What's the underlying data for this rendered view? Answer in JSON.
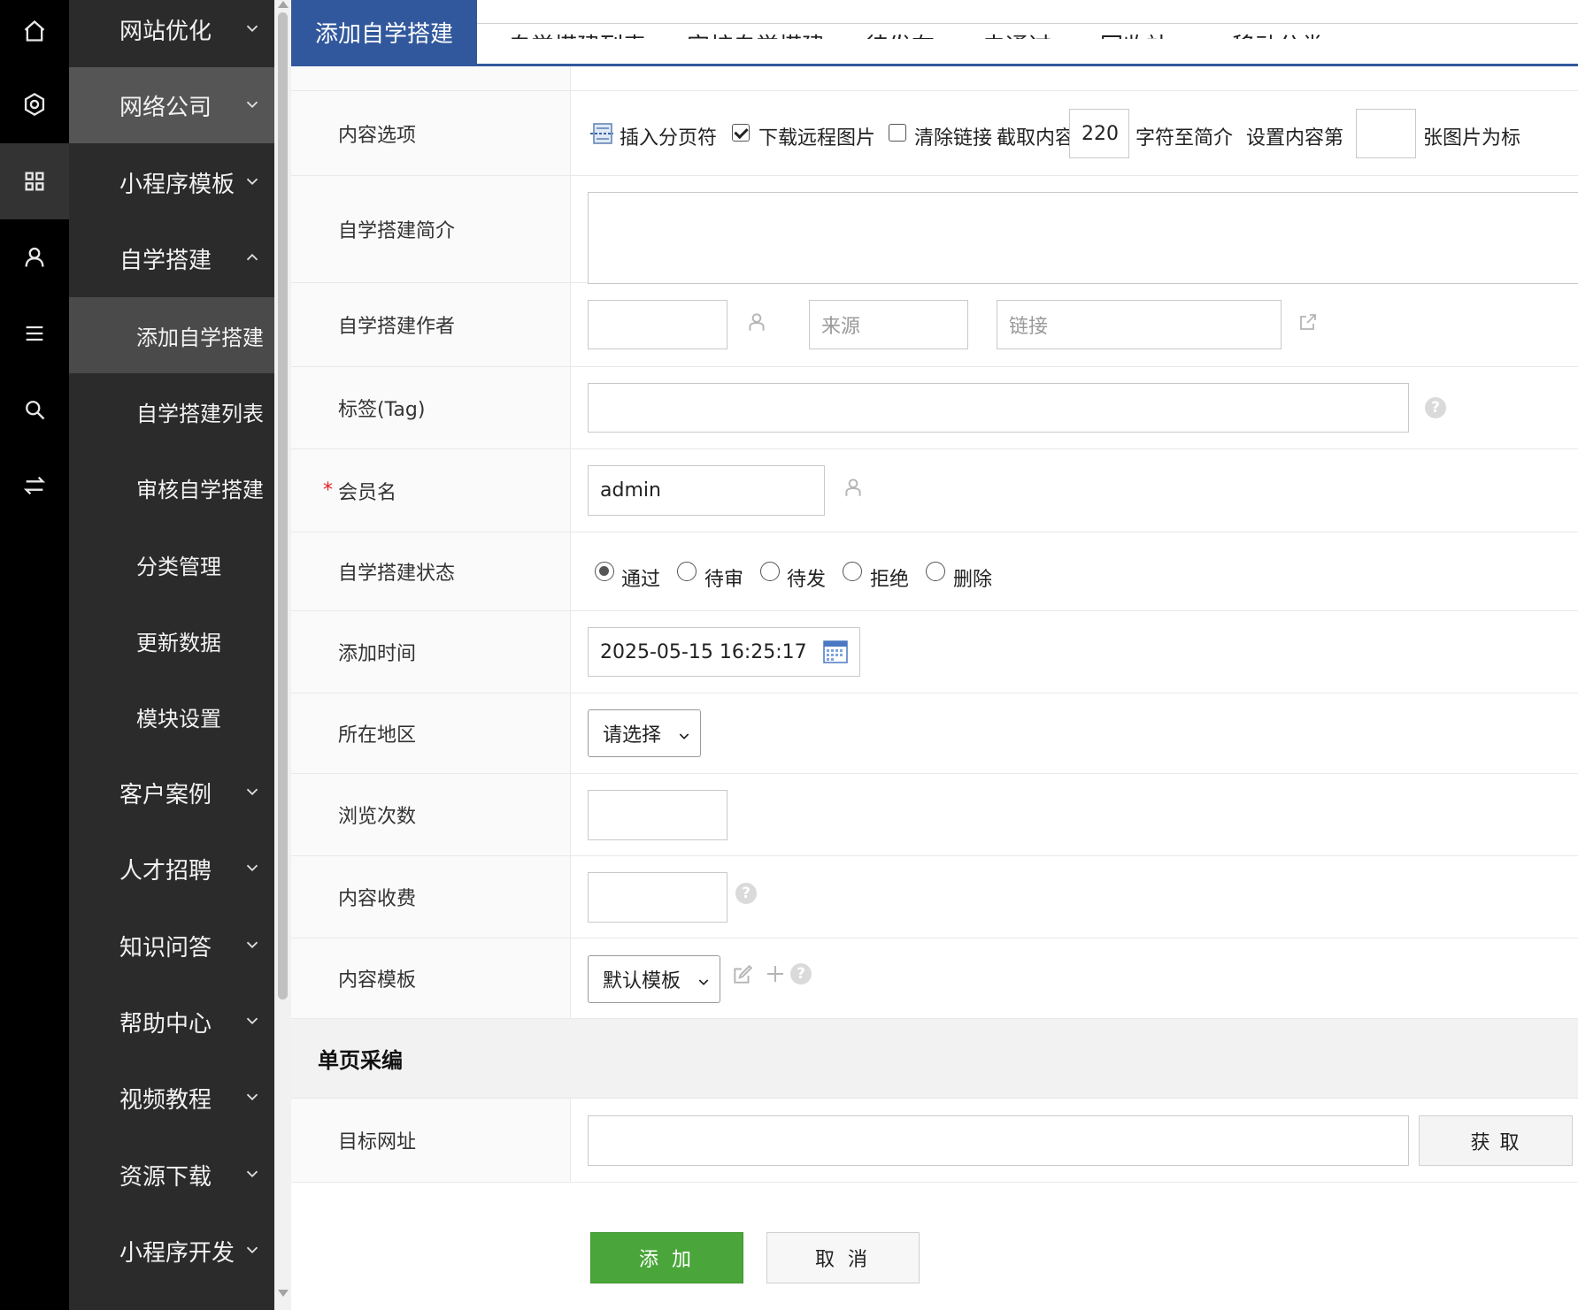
{
  "icon_bar": [
    "home-icon",
    "settings-icon",
    "grid-icon",
    "user-icon",
    "list-icon",
    "search-icon",
    "switch-icon"
  ],
  "side_menu": {
    "top_items": [
      {
        "label": "网站优化"
      },
      {
        "label": "网络公司"
      },
      {
        "label": "小程序模板"
      },
      {
        "label": "自学搭建"
      }
    ],
    "sub_items": [
      {
        "label": "添加自学搭建"
      },
      {
        "label": "自学搭建列表"
      },
      {
        "label": "审核自学搭建"
      },
      {
        "label": "分类管理"
      },
      {
        "label": "更新数据"
      },
      {
        "label": "模块设置"
      }
    ],
    "bottom_items": [
      {
        "label": "客户案例"
      },
      {
        "label": "人才招聘"
      },
      {
        "label": "知识问答"
      },
      {
        "label": "帮助中心"
      },
      {
        "label": "视频教程"
      },
      {
        "label": "资源下载"
      },
      {
        "label": "小程序开发"
      }
    ]
  },
  "tabs": [
    "添加自学搭建",
    "自学搭建列表",
    "审核自学搭建",
    "待发布",
    "未通过",
    "回收站",
    "移动分类"
  ],
  "form": {
    "content_options": {
      "label": "内容选项",
      "insert_pagebreak": "插入分页符",
      "download_remote_images": "下载远程图片",
      "clear_links": "清除链接",
      "extract_prefix": "截取内容",
      "extract_count": "220",
      "extract_suffix": "字符至简介",
      "set_prefix": "设置内容第",
      "set_count": "",
      "set_suffix": "张图片为标"
    },
    "intro": {
      "label": "自学搭建简介",
      "value": ""
    },
    "author": {
      "label": "自学搭建作者",
      "value": "",
      "source_placeholder": "来源",
      "link_placeholder": "链接"
    },
    "tag": {
      "label": "标签(Tag)",
      "value": ""
    },
    "member": {
      "required_mark": "*",
      "label": "会员名",
      "value": "admin"
    },
    "status": {
      "label": "自学搭建状态",
      "options": [
        "通过",
        "待审",
        "待发",
        "拒绝",
        "删除"
      ],
      "selected": "通过"
    },
    "add_time": {
      "label": "添加时间",
      "value": "2025-05-15 16:25:17"
    },
    "region": {
      "label": "所在地区",
      "selected": "请选择"
    },
    "views": {
      "label": "浏览次数",
      "value": ""
    },
    "fee": {
      "label": "内容收费",
      "value": ""
    },
    "template": {
      "label": "内容模板",
      "selected": "默认模板"
    }
  },
  "single_page": {
    "section_title": "单页采编",
    "target_url": {
      "label": "目标网址",
      "value": ""
    },
    "fetch_label": "获 取"
  },
  "actions": {
    "add_label": "添 加",
    "cancel_label": "取 消"
  },
  "colors": {
    "accent": "#31589c",
    "add_button": "#4aa63a",
    "sidebar": "#2b2b2b",
    "iconbar": "#000000"
  }
}
